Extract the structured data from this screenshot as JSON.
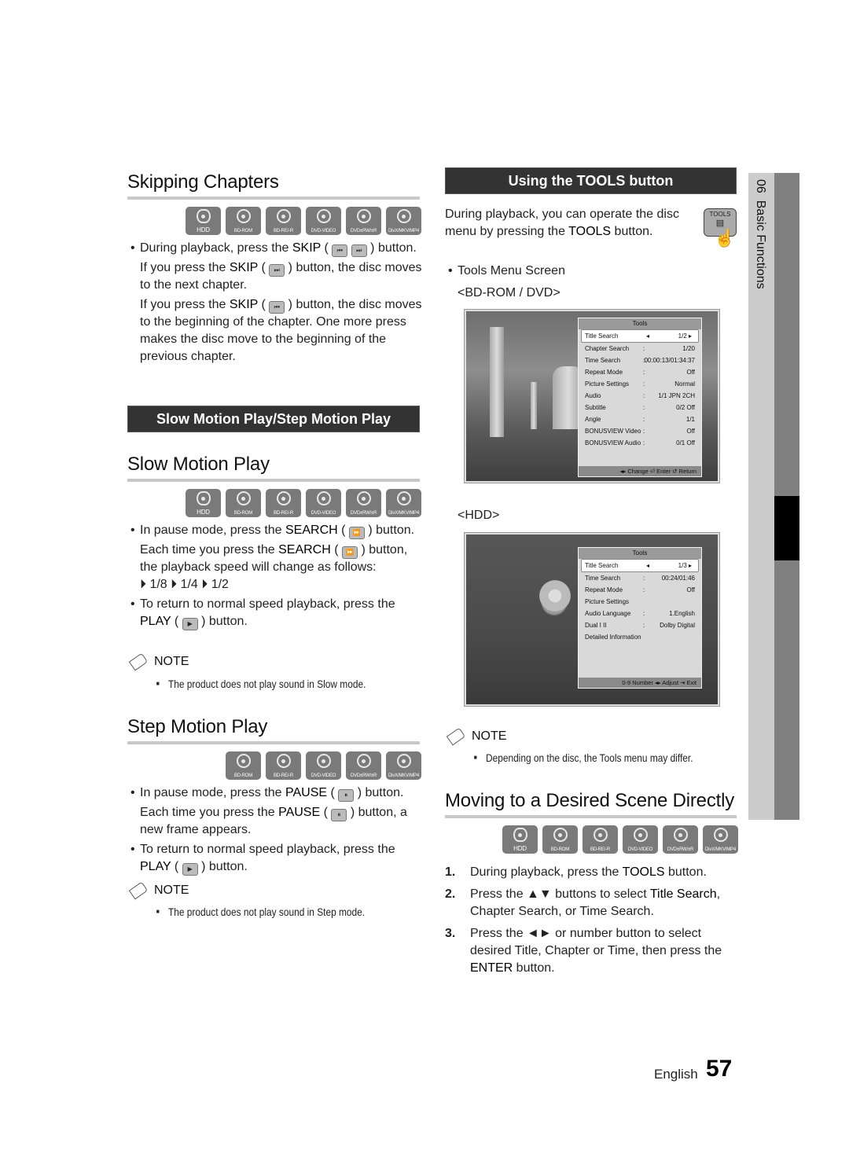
{
  "left": {
    "skipping": {
      "title": "Skipping Chapters",
      "disc_icons": [
        "HDD",
        "BD-ROM",
        "BD-RE/-R",
        "DVD-VIDEO",
        "DVD±RW/±R",
        "DivX/MKV/MP4"
      ],
      "bullet1_pre": "During playback, press the ",
      "bullet1_bold": "SKIP",
      "bullet1_post": " button.",
      "para1_pre": "If you press the ",
      "para1_bold": "SKIP",
      "para1_post": " button, the disc moves to the next chapter.",
      "para2_pre": "If you press the ",
      "para2_bold": "SKIP",
      "para2_post": " button, the disc moves to the beginning of the chapter. One more press makes the disc move to the beginning of the previous chapter."
    },
    "section_bar": "Slow Motion Play/Step Motion Play",
    "slow": {
      "title": "Slow Motion Play",
      "disc_icons": [
        "HDD",
        "BD-ROM",
        "BD-RE/-R",
        "DVD-VIDEO",
        "DVD±RW/±R",
        "DivX/MKV/MP4"
      ],
      "bullet1_pre": "In pause mode, press the ",
      "bullet1_bold": "SEARCH",
      "bullet1_post": " button.",
      "para_pre": "Each time you press the ",
      "para_bold": "SEARCH",
      "para_post": " button, the playback speed will change as follows:",
      "speeds": "⏵ 1/8 ⏵ 1/4 ⏵ 1/2",
      "bullet2_pre": "To return to normal speed playback, press the ",
      "bullet2_bold": "PLAY",
      "bullet2_post": " button.",
      "note_label": "NOTE",
      "note": "The product does not play sound in Slow mode."
    },
    "step": {
      "title": "Step Motion Play",
      "disc_icons": [
        "BD-ROM",
        "BD-RE/-R",
        "DVD-VIDEO",
        "DVD±RW/±R",
        "DivX/MKV/MP4"
      ],
      "bullet1_pre": "In pause mode, press the ",
      "bullet1_bold": "PAUSE",
      "bullet1_post": " button.",
      "para_pre": "Each time you press the ",
      "para_bold": "PAUSE",
      "para_post": " button, a new frame appears.",
      "bullet2_pre": "To return to normal speed playback, press the ",
      "bullet2_bold": "PLAY",
      "bullet2_post": " button.",
      "note_label": "NOTE",
      "note": "The product does not play sound in Step mode."
    }
  },
  "right": {
    "section_bar": "Using the TOOLS button",
    "intro_pre": "During playback, you can operate the disc menu by pressing the ",
    "intro_bold": "TOOLS",
    "intro_post": " button.",
    "tools_key_label": "TOOLS",
    "bullet": "Tools Menu Screen",
    "bd_label": "<BD-ROM / DVD>",
    "bd_menu": {
      "title": "Tools",
      "rows": [
        {
          "label": "Title Search",
          "sep": "◂",
          "value": "1/2",
          "selected": true
        },
        {
          "label": "Chapter Search",
          "sep": ":",
          "value": "1/20"
        },
        {
          "label": "Time Search",
          "sep": ":",
          "value": "00:00:13/01:34:37"
        },
        {
          "label": "Repeat Mode",
          "sep": ":",
          "value": "Off"
        },
        {
          "label": "Picture Settings",
          "sep": ":",
          "value": "Normal"
        },
        {
          "label": "Audio",
          "sep": ":",
          "value": "1/1 JPN 2CH"
        },
        {
          "label": "Subtitle",
          "sep": ":",
          "value": "0/2 Off"
        },
        {
          "label": "Angle",
          "sep": ":",
          "value": "1/1"
        },
        {
          "label": "BONUSVIEW Video",
          "sep": ":",
          "value": "Off"
        },
        {
          "label": "BONUSVIEW Audio",
          "sep": ":",
          "value": "0/1 Off"
        }
      ],
      "footer": "◂▸ Change   ⏎ Enter   ↺ Return"
    },
    "hdd_label": "<HDD>",
    "hdd_menu": {
      "title": "Tools",
      "rows": [
        {
          "label": "Title Search",
          "sep": "◂",
          "value": "1/3",
          "selected": true
        },
        {
          "label": "Time Search",
          "sep": ":",
          "value": "00:24/01:46"
        },
        {
          "label": "Repeat Mode",
          "sep": ":",
          "value": "Off"
        },
        {
          "label": "Picture Settings",
          "sep": "",
          "value": ""
        },
        {
          "label": "Audio Language",
          "sep": ":",
          "value": "1.English"
        },
        {
          "label": "Dual I II",
          "sep": ":",
          "value": "Dolby Digital"
        },
        {
          "label": "Detailed Information",
          "sep": "",
          "value": ""
        }
      ],
      "footer": "0-9 Number   ◂▸ Adjust   ⇥ Exit"
    },
    "note_label": "NOTE",
    "note": "Depending on the disc, the Tools menu may differ.",
    "moving": {
      "title": "Moving to a Desired Scene Directly",
      "disc_icons": [
        "HDD",
        "BD-ROM",
        "BD-RE/-R",
        "DVD-VIDEO",
        "DVD±RW/±R",
        "DivX/MKV/MP4"
      ],
      "steps": [
        {
          "num": "1.",
          "pre": "During playback, press the ",
          "bold": "TOOLS",
          "post": " button."
        },
        {
          "num": "2.",
          "pre": "Press the ▲▼ buttons to select ",
          "bold": "Title Search",
          "post": ", Chapter Search, or Time Search."
        },
        {
          "num": "3.",
          "pre": "Press the ◄► or number button to select desired Title, Chapter or Time, then press the ",
          "bold": "ENTER",
          "post": " button."
        }
      ]
    }
  },
  "side_tab": {
    "chapter": "06",
    "label": "Basic Functions"
  },
  "footer": {
    "language": "English",
    "page": "57"
  }
}
